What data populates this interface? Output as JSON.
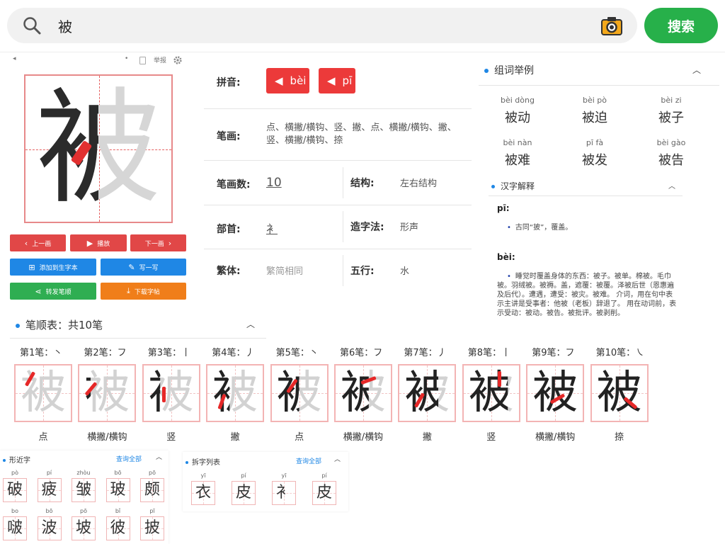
{
  "search": {
    "value": "被",
    "button_label": "搜索"
  },
  "toolbar": {
    "report_label": "举报"
  },
  "controls": {
    "prev_label": "上一画",
    "play_label": "播放",
    "next_label": "下一画",
    "add_label": "添加到生字本",
    "write_label": "写一写",
    "share_label": "转发笔顺",
    "download_label": "下载字帖"
  },
  "big_char": "被",
  "info": {
    "pinyin_label": "拼音:",
    "pinyin": [
      "bèi",
      "pī"
    ],
    "strokes_label": "笔画:",
    "strokes_value": "点、横撇/横钩、竖、撇、点、横撇/横钩、撇、竖、横撇/横钩、捺",
    "count_label": "笔画数:",
    "count_value": "10",
    "structure_label": "结构:",
    "structure_value": "左右结构",
    "radical_label": "部首:",
    "radical_value": "衤",
    "formation_label": "造字法:",
    "formation_value": "形声",
    "traditional_label": "繁体:",
    "traditional_value": "繁简相同",
    "wuxing_label": "五行:",
    "wuxing_value": "水"
  },
  "words": {
    "title": "组词举例",
    "items": [
      {
        "py": "bèi dòng",
        "hz": "被动"
      },
      {
        "py": "bèi pò",
        "hz": "被迫"
      },
      {
        "py": "bèi zi",
        "hz": "被子"
      },
      {
        "py": "bèi nàn",
        "hz": "被难"
      },
      {
        "py": "pī fà",
        "hz": "被发"
      },
      {
        "py": "bèi gào",
        "hz": "被告"
      }
    ]
  },
  "definitions": {
    "title": "汉字解释",
    "pi_head": "pī:",
    "pi_text": "古同“披”，覆盖。",
    "bei_head": "bèi:",
    "bei_text": "睡觉时覆盖身体的东西：被子。被单。棉被。毛巾被。羽绒被。被褥。盖，遮覆：被覆。泽被后世（恩惠遍及后代）。遭遇，遭受：被灾。被难。 介词，用在句中表示主讲是受事者：他被（老板）辞退了。 用在动词前，表示受动：被动。被告。被批评。被剥削。"
  },
  "stroke_order": {
    "title": "笔顺表：共10笔",
    "nums": [
      "第1笔：丶",
      "第2笔：フ",
      "第3笔：丨",
      "第4笔：丿",
      "第5笔：丶",
      "第6笔：フ",
      "第7笔：丿",
      "第8笔：丨",
      "第9笔：フ",
      "第10笔：㇏"
    ],
    "names": [
      "点",
      "横撇/横钩",
      "竖",
      "撇",
      "点",
      "横撇/横钩",
      "撇",
      "竖",
      "横撇/横钩",
      "捺"
    ],
    "char": "被"
  },
  "similar": {
    "title": "形近字",
    "more_label": "查询全部",
    "items": [
      {
        "py": "pò",
        "hz": "破"
      },
      {
        "py": "pí",
        "hz": "疲"
      },
      {
        "py": "zhòu",
        "hz": "皱"
      },
      {
        "py": "bō",
        "hz": "玻"
      },
      {
        "py": "pō",
        "hz": "颇"
      },
      {
        "py": "bo",
        "hz": "啵"
      },
      {
        "py": "bō",
        "hz": "波"
      },
      {
        "py": "pō",
        "hz": "坡"
      },
      {
        "py": "bǐ",
        "hz": "彼"
      },
      {
        "py": "pī",
        "hz": "披"
      }
    ]
  },
  "split": {
    "title": "拆字列表",
    "more_label": "查询全部",
    "items": [
      {
        "py": "yī",
        "hz": "衣"
      },
      {
        "py": "pí",
        "hz": "皮"
      },
      {
        "py": "yī",
        "hz": "衤"
      },
      {
        "py": "pí",
        "hz": "皮"
      }
    ]
  }
}
